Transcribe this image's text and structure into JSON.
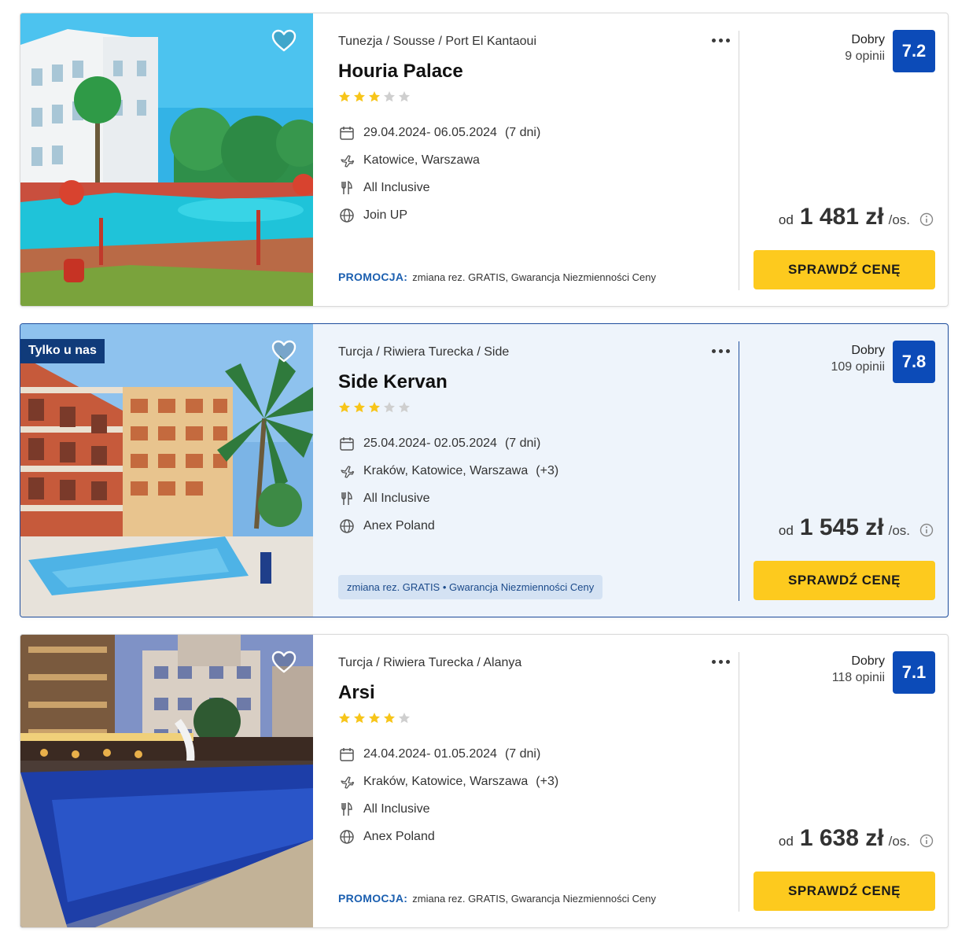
{
  "offers": [
    {
      "location": "Tunezja / Sousse / Port El Kantaoui",
      "name": "Houria Palace",
      "stars": 3,
      "dates": "29.04.2024- 06.05.2024",
      "duration": "(7 dni)",
      "departure": "Katowice, Warszawa",
      "departure_extra": "",
      "board": "All Inclusive",
      "operator": "Join UP",
      "promo_label": "PROMOCJA:",
      "promo_text": "zmiana rez. GRATIS, Gwarancja Niezmienności Ceny",
      "rating_label": "Dobry",
      "reviews": "9 opinii",
      "score": "7.2",
      "price_prefix": "od",
      "price": "1 481 zł",
      "price_suffix": "/os.",
      "cta": "SPRAWDŹ CENĘ"
    },
    {
      "badge": "Tylko u nas",
      "location": "Turcja / Riwiera Turecka / Side",
      "name": "Side Kervan",
      "stars": 3,
      "dates": "25.04.2024- 02.05.2024",
      "duration": "(7 dni)",
      "departure": "Kraków, Katowice, Warszawa",
      "departure_extra": "(+3)",
      "board": "All Inclusive",
      "operator": "Anex Poland",
      "promo_pill": "zmiana rez. GRATIS • Gwarancja Niezmienności Ceny",
      "rating_label": "Dobry",
      "reviews": "109 opinii",
      "score": "7.8",
      "price_prefix": "od",
      "price": "1 545 zł",
      "price_suffix": "/os.",
      "cta": "SPRAWDŹ CENĘ"
    },
    {
      "location": "Turcja / Riwiera Turecka / Alanya",
      "name": "Arsi",
      "stars": 4,
      "dates": "24.04.2024- 01.05.2024",
      "duration": "(7 dni)",
      "departure": "Kraków, Katowice, Warszawa",
      "departure_extra": "(+3)",
      "board": "All Inclusive",
      "operator": "Anex Poland",
      "promo_label": "PROMOCJA:",
      "promo_text": "zmiana rez. GRATIS, Gwarancja Niezmienności Ceny",
      "rating_label": "Dobry",
      "reviews": "118 opinii",
      "score": "7.1",
      "price_prefix": "od",
      "price": "1 638 zł",
      "price_suffix": "/os.",
      "cta": "SPRAWDŹ CENĘ"
    }
  ],
  "icons": {
    "favorite": "heart-outline-icon",
    "more": "more-dots-icon",
    "star": "star-icon",
    "dates": "calendar-icon",
    "departure": "plane-icon",
    "board": "cutlery-icon",
    "operator": "globe-icon",
    "price_info": "info-circle-icon"
  },
  "colors": {
    "star_filled": "#f7c51a",
    "star_empty": "#cfcfcf",
    "score_bg": "#0c4bb8",
    "cta_bg": "#fdca1e",
    "promo_label": "#1b5fb0",
    "badge_bg": "#103b7a",
    "highlight_bg": "#eef4fb",
    "highlight_border": "#1f4e9e"
  }
}
